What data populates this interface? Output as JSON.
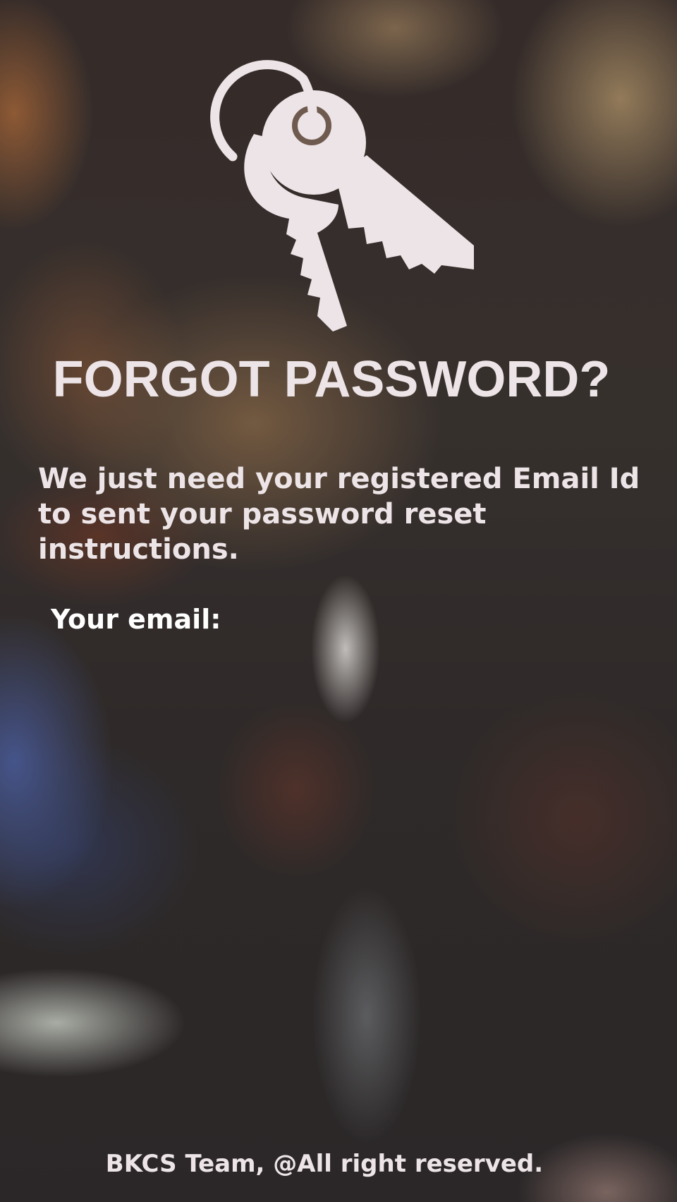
{
  "header": {
    "icon": "keys-icon",
    "title": "FORGOT PASSWORD?",
    "subtitle": "We just need your registered Email Id to sent your password reset instructions."
  },
  "form": {
    "email_label": "Your email:",
    "email_value": "",
    "email_placeholder": ""
  },
  "footer": {
    "text": "BKCS Team, @All right reserved."
  },
  "colors": {
    "text": "#ece4e6",
    "icon": "#ece4e6"
  }
}
